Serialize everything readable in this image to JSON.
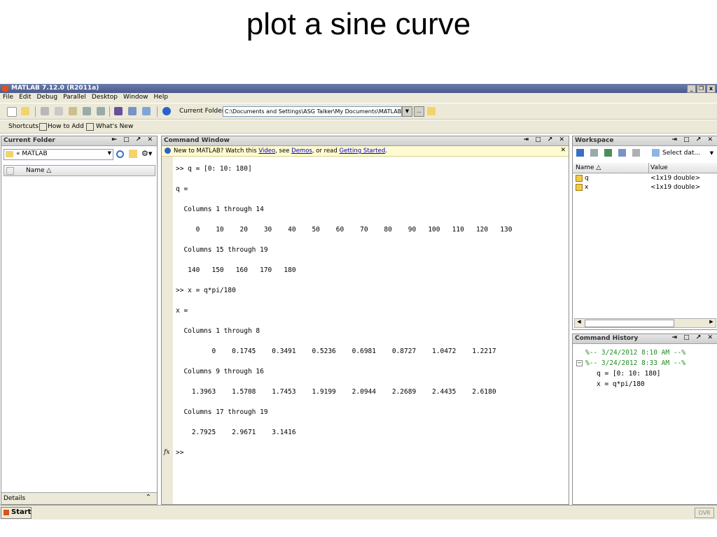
{
  "slide": {
    "title": "plot a sine curve"
  },
  "window": {
    "title": "MATLAB 7.12.0 (R2011a)",
    "min_label": "_",
    "max_label": "❐",
    "close_label": "x"
  },
  "menu": [
    "File",
    "Edit",
    "Debug",
    "Parallel",
    "Desktop",
    "Window",
    "Help"
  ],
  "toolbar": {
    "current_folder_label": "Current Folder:",
    "current_folder_path": "C:\\Documents and Settings\\ASG Talker\\My Documents\\MATLAB",
    "browse_label": "..."
  },
  "shortcuts": {
    "shortcuts_label": "Shortcuts",
    "how_to_add": "How to Add",
    "whats_new": "What's New"
  },
  "current_folder_panel": {
    "title": "Current Folder",
    "path": "« MATLAB",
    "column_name": "Name △",
    "details_label": "Details"
  },
  "command_window": {
    "title": "Command Window",
    "banner_prefix": "New to MATLAB? Watch this ",
    "banner_video": "Video",
    "banner_mid": ", see ",
    "banner_demos": "Demos",
    "banner_mid2": ", or read ",
    "banner_started": "Getting Started",
    "banner_end": ".",
    "lines": [
      ">> q = [0: 10: 180]",
      "q =",
      "  Columns 1 through 14",
      "     0    10    20    30    40    50    60    70    80    90   100   110   120   130",
      "  Columns 15 through 19",
      "   140   150   160   170   180",
      ">> x = q*pi/180",
      "x =",
      "  Columns 1 through 8",
      "         0    0.1745    0.3491    0.5236    0.6981    0.8727    1.0472    1.2217",
      "  Columns 9 through 16",
      "    1.3963    1.5708    1.7453    1.9199    2.0944    2.2689    2.4435    2.6180",
      "  Columns 17 through 19",
      "    2.7925    2.9671    3.1416",
      ">>"
    ],
    "fx_label": "fx"
  },
  "workspace": {
    "title": "Workspace",
    "select_data_label": "Select dat...",
    "col_name": "Name △",
    "col_value": "Value",
    "rows": [
      {
        "name": "q",
        "value": "<1x19 double>"
      },
      {
        "name": "x",
        "value": "<1x19 double>"
      }
    ]
  },
  "history": {
    "title": "Command History",
    "entries": [
      "%-- 3/24/2012 8:10 AM --%",
      "%-- 3/24/2012 8:33 AM --%",
      "q = [0: 10: 180]",
      "x = q*pi/180"
    ]
  },
  "statusbar": {
    "start_label": "Start",
    "ovr_label": "OVR"
  },
  "colors": {
    "title_bar": "#4a5a8c",
    "chrome": "#ece9d8",
    "history_green": "#228b22",
    "link_blue": "#0000cc"
  }
}
